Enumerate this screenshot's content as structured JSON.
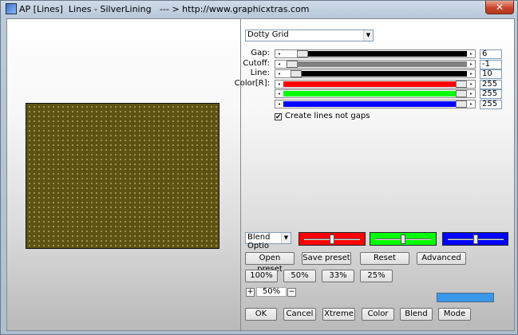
{
  "window": {
    "title": "AP [Lines]  Lines - SilverLining   --- > http://www.graphicxtras.com",
    "close_label": "✕"
  },
  "colors": {
    "preview_bg": "#5c5313",
    "preview_dots": "#a59c55",
    "accent": "#3a98ea"
  },
  "effect": {
    "selected": "Dotty Grid"
  },
  "controls": [
    {
      "label": "Gap:",
      "value": "6",
      "fill_color": "#000000",
      "level": 0.08
    },
    {
      "label": "Cutoff:",
      "value": "-1",
      "fill_color": "#808080",
      "level": 0.02
    },
    {
      "label": "Line:",
      "value": "10",
      "fill_color": "#000000",
      "level": 0.04
    },
    {
      "label": "Color[R]:",
      "value": "255",
      "fill_color": "#ff0000",
      "level": 1.0
    },
    {
      "label": "",
      "value": "255",
      "fill_color": "#00ff00",
      "level": 1.0
    },
    {
      "label": "",
      "value": "255",
      "fill_color": "#0000ff",
      "level": 1.0
    }
  ],
  "checkbox": {
    "label": "Create lines not gaps",
    "checked": true,
    "mark": "✔"
  },
  "blend": {
    "selected": "Blend Optio"
  },
  "swatches": [
    {
      "color": "#ff0000",
      "level": 0.5
    },
    {
      "color": "#00ff00",
      "level": 0.5
    },
    {
      "color": "#0000ff",
      "level": 0.5
    }
  ],
  "preset_buttons": {
    "open": "Open preset",
    "save": "Save preset",
    "reset": "Reset",
    "advanced": "Advanced"
  },
  "zoom_buttons": {
    "z100": "100%",
    "z50": "50%",
    "z33": "33%",
    "z25": "25%"
  },
  "zoom": {
    "plus": "+",
    "value": "50%",
    "minus": "−"
  },
  "bottom_buttons": {
    "ok": "OK",
    "cancel": "Cancel",
    "xtreme": "Xtreme",
    "color": "Color",
    "blend": "Blend",
    "mode": "Mode"
  }
}
